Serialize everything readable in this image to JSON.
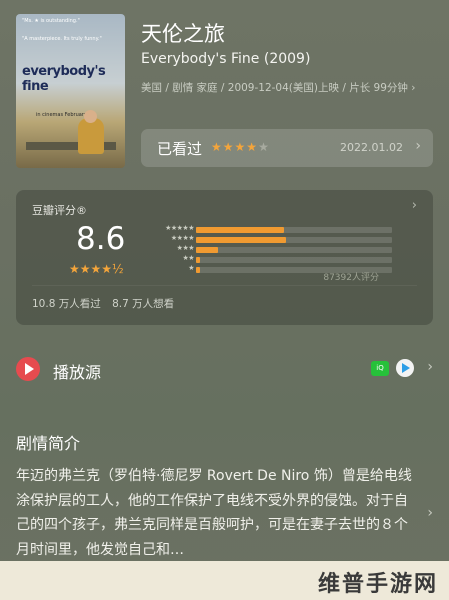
{
  "movie": {
    "title": "天伦之旅",
    "original_title": "Everybody's Fine (2009)",
    "meta": "美国 / 剧情 家庭 / 2009-12-04(美国)上映 / 片长 99分钟 ›",
    "poster": {
      "quote1": "\"Ms. ★ is outstanding.\"",
      "quote2": "\"A masterpiece. Its truly funny.\"",
      "title": "everybody's fine",
      "date": "in cinemas February 26"
    }
  },
  "watched": {
    "label": "已看过",
    "stars": 4,
    "max_stars": 5,
    "date": "2022.01.02",
    "chevron": "›"
  },
  "rating": {
    "heading": "豆瓣评分®",
    "score": "8.6",
    "stars_text": "★★★★½",
    "chevron": "›",
    "distribution": [
      {
        "label": "★★★★★",
        "percent": 45
      },
      {
        "label": "★★★★",
        "percent": 46
      },
      {
        "label": "★★★",
        "percent": 11
      },
      {
        "label": "★★",
        "percent": 2
      },
      {
        "label": "★",
        "percent": 1
      }
    ],
    "count": "87392人评分",
    "watched_count": "10.8 万人看过",
    "want_count": "8.7 万人想看"
  },
  "play": {
    "label": "播放源",
    "iqiyi_icon_text": "爱奇艺",
    "chevron": "›"
  },
  "synopsis": {
    "title": "剧情简介",
    "text": "年迈的弗兰克（罗伯特·德尼罗 Rovert De Niro 饰）曾是给电线涂保护层的工人，他的工作保护了电线不受外界的侵蚀。对于自己的四个孩子，弗兰克同样是百般呵护，可是在妻子去世的８个月时间里，他发觉自己和…",
    "chevron": "›"
  },
  "watermark": "维普手游网",
  "colors": {
    "accent_star": "#f4a53b",
    "bar": "#f09a31",
    "play_red": "#e64b4f",
    "iqiyi_green": "#26c13a"
  }
}
